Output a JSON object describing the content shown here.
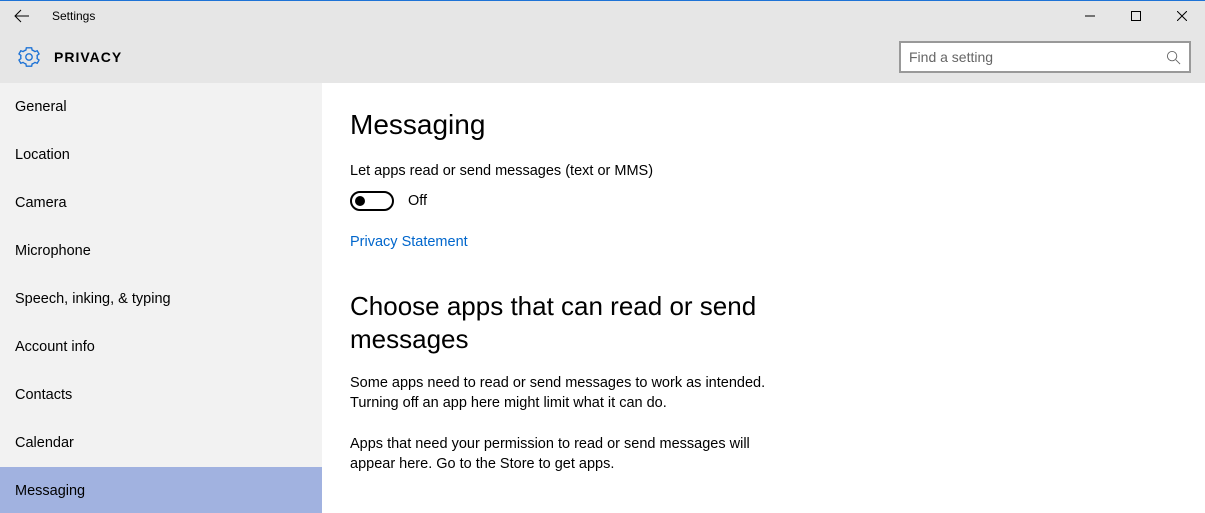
{
  "titlebar": {
    "title": "Settings"
  },
  "header": {
    "title": "PRIVACY",
    "search_placeholder": "Find a setting"
  },
  "sidebar": {
    "items": [
      {
        "label": "General",
        "selected": false
      },
      {
        "label": "Location",
        "selected": false
      },
      {
        "label": "Camera",
        "selected": false
      },
      {
        "label": "Microphone",
        "selected": false
      },
      {
        "label": "Speech, inking, & typing",
        "selected": false
      },
      {
        "label": "Account info",
        "selected": false
      },
      {
        "label": "Contacts",
        "selected": false
      },
      {
        "label": "Calendar",
        "selected": false
      },
      {
        "label": "Messaging",
        "selected": true
      }
    ]
  },
  "main": {
    "page_title": "Messaging",
    "toggle_label": "Let apps read or send messages (text or MMS)",
    "toggle_state": "Off",
    "privacy_link": "Privacy Statement",
    "section_title": "Choose apps that can read or send messages",
    "body1": "Some apps need to read or send messages to work as intended. Turning off an app here might limit what it can do.",
    "body2": "Apps that need your permission to read or send messages will appear here. Go to the Store to get apps."
  }
}
